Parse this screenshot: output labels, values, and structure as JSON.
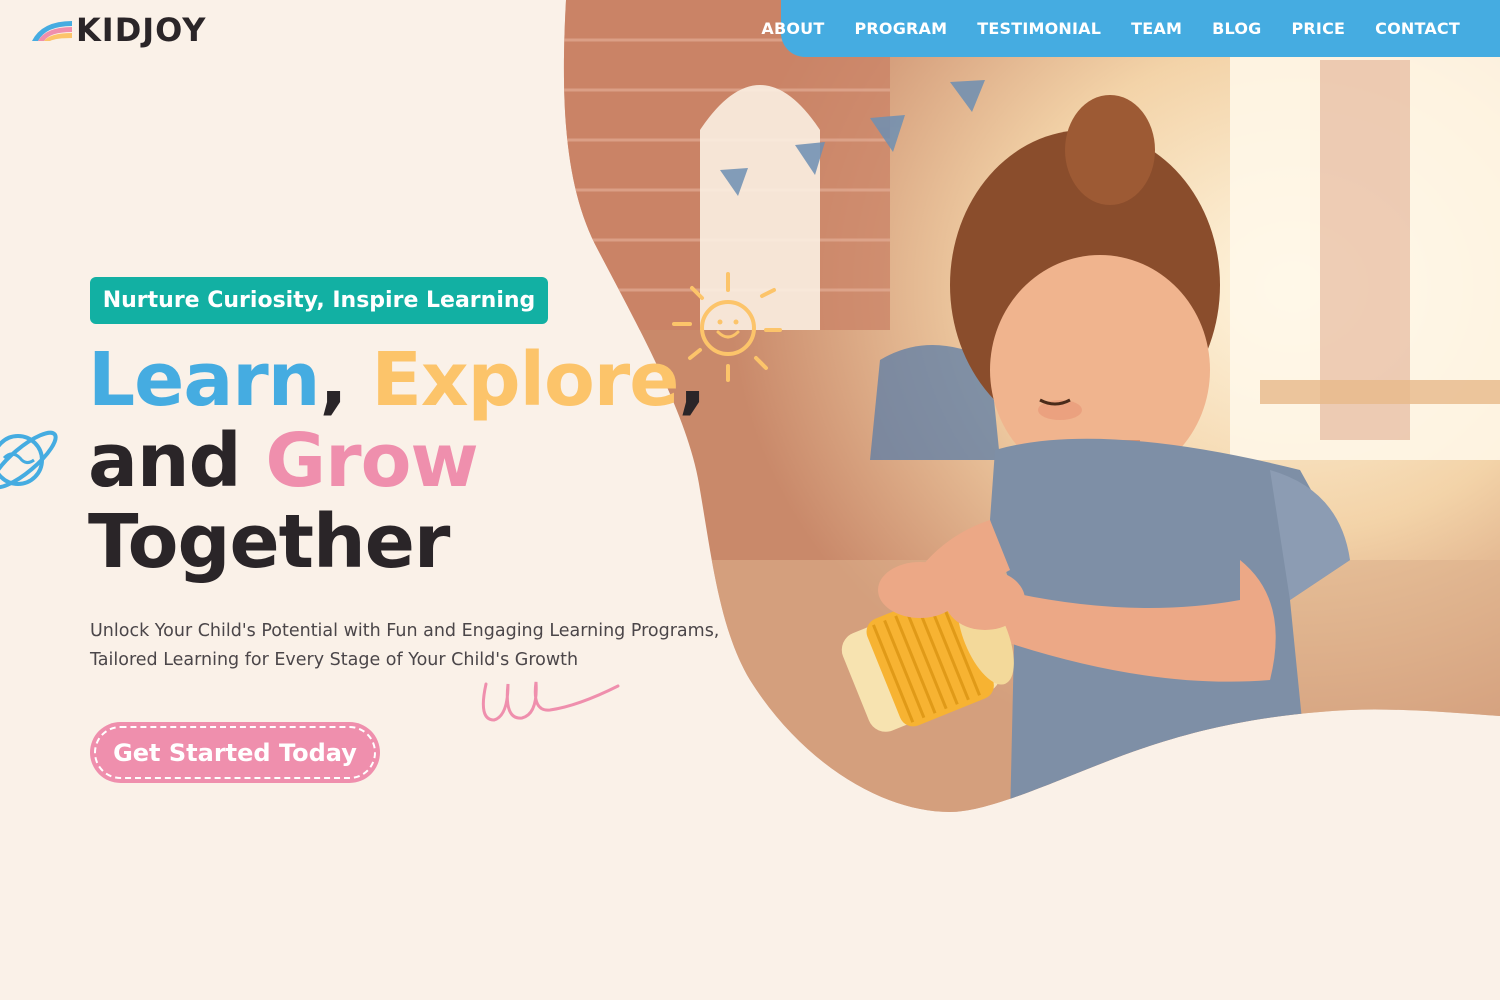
{
  "brand": {
    "name": "KIDJOY"
  },
  "nav": {
    "items": [
      "ABOUT",
      "PROGRAM",
      "TESTIMONIAL",
      "TEAM",
      "BLOG",
      "PRICE",
      "CONTACT"
    ]
  },
  "hero": {
    "tagline": "Nurture Curiosity, Inspire Learning",
    "headline": {
      "word1": "Learn",
      "comma1": ",",
      "word2": "Explore",
      "comma2": ",",
      "and": "and",
      "word3": "Grow",
      "word4": "Together"
    },
    "subtext": "Unlock Your Child's Potential with Fun and Engaging Learning Programs, Tailored Learning for Every Stage of Your Child's Growth",
    "cta_label": "Get Started Today"
  },
  "colors": {
    "background": "#faf1e8",
    "nav": "#45ace1",
    "tagline_bg": "#12b0a3",
    "blue": "#45ace1",
    "yellow": "#fcc46a",
    "pink": "#ef8fad",
    "dark": "#2a2528"
  },
  "icons": [
    "rainbow-logo-icon",
    "smiley-face-icon",
    "sun-doodle-icon",
    "planet-doodle-icon",
    "squiggle-doodle-icon"
  ],
  "image": {
    "alt": "Toddler girl playing with stacking cups in a bright classroom"
  }
}
